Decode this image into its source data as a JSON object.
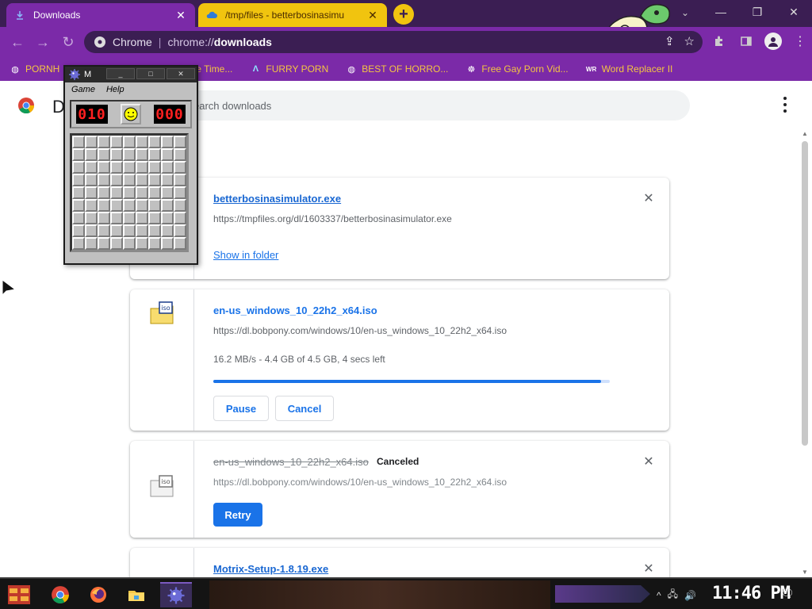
{
  "browser": {
    "tabs": [
      {
        "title": "Downloads",
        "active": true
      },
      {
        "title": "/tmp/files - betterbosinasimu",
        "active": false
      }
    ],
    "new_tab_label": "+",
    "window_controls": {
      "minimize": "—",
      "restore": "❐",
      "close": "✕"
    },
    "tab_search": "⌄"
  },
  "toolbar": {
    "back": "←",
    "forward": "→",
    "reload": "↻",
    "omnibox": {
      "chip": "Chrome",
      "separator": "|",
      "scheme": "chrome://",
      "host": "downloads"
    },
    "share_icon": "⇪",
    "star_icon": "☆"
  },
  "bookmarks": [
    {
      "label": "PORNH",
      "icon": "globe-icon"
    },
    {
      "label": "e Time...",
      "icon": "globe-icon"
    },
    {
      "label": "FURRY PORN",
      "icon": "lambda-icon"
    },
    {
      "label": "BEST OF HORRO...",
      "icon": "globe-icon"
    },
    {
      "label": "Free Gay Porn Vid...",
      "icon": "globe-icon"
    },
    {
      "label": "Word Replacer II",
      "icon": "wr-icon"
    }
  ],
  "downloads_page": {
    "heading": "D",
    "search_placeholder": "earch downloads",
    "items": [
      {
        "filename": "betterbosinasimulator.exe",
        "url": "https://tmpfiles.org/dl/1603337/betterbosinasimulator.exe",
        "action": "Show in folder"
      },
      {
        "filename": "en-us_windows_10_22h2_x64.iso",
        "url": "https://dl.bobpony.com/windows/10/en-us_windows_10_22h2_x64.iso",
        "progress_text": "16.2 MB/s - 4.4 GB of 4.5 GB, 4 secs left",
        "progress_fraction": 0.978,
        "pause_label": "Pause",
        "cancel_label": "Cancel",
        "icon_label": "iso"
      },
      {
        "filename": "en-us_windows_10_22h2_x64.iso",
        "status": "Canceled",
        "url": "https://dl.bobpony.com/windows/10/en-us_windows_10_22h2_x64.iso",
        "retry_label": "Retry",
        "icon_label": "iso"
      },
      {
        "filename": "Motrix-Setup-1.8.19.exe"
      }
    ]
  },
  "minesweeper": {
    "title": "M",
    "title_buttons": {
      "minimize": "_",
      "maximize": "□",
      "close": "✕"
    },
    "menu": [
      "Game",
      "Help"
    ],
    "mines_counter": "010",
    "timer": "000",
    "rows": 9,
    "cols": 9
  },
  "taskbar": {
    "clock": "11:46 PM",
    "tray_chevron": "^",
    "tray_network": "🖧",
    "tray_volume": "🔊",
    "notifications": "🗨"
  },
  "colors": {
    "tab_strip": "#3b1e53",
    "toolbar": "#7b2aa8",
    "accent_yellow": "#f1c40f",
    "link_blue": "#1a73e8"
  }
}
